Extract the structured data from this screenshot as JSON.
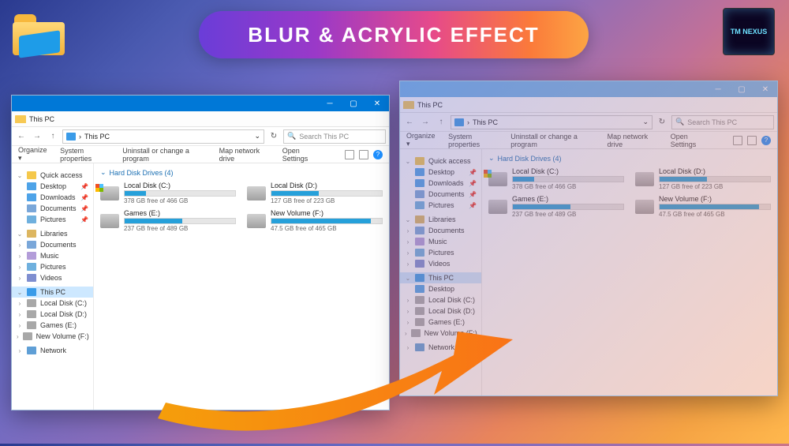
{
  "title_pill": "BLUR & ACRYLIC EFFECT",
  "nexus_label": "TM NEXUS",
  "window": {
    "tab_label": "This PC",
    "addr_location": "This PC",
    "search_placeholder": "Search This PC",
    "cmd": {
      "organize": "Organize ▾",
      "sysprops": "System properties",
      "uninstall": "Uninstall or change a program",
      "mapnet": "Map network drive",
      "opensettings": "Open Settings",
      "help": "?"
    },
    "section_header": "Hard Disk Drives (4)",
    "drives": [
      {
        "name": "Local Disk (C:)",
        "free": "378 GB free of 466 GB",
        "pct": 19
      },
      {
        "name": "Local Disk (D:)",
        "free": "127 GB free of 223 GB",
        "pct": 43
      },
      {
        "name": "Games (E:)",
        "free": "237 GB free of 489 GB",
        "pct": 52
      },
      {
        "name": "New Volume (F:)",
        "free": "47.5 GB free of 465 GB",
        "pct": 90
      }
    ]
  },
  "sidebar": {
    "qa": "Quick access",
    "desktop": "Desktop",
    "downloads": "Downloads",
    "documents": "Documents",
    "pictures": "Pictures",
    "libraries": "Libraries",
    "lib_documents": "Documents",
    "lib_music": "Music",
    "lib_pictures": "Pictures",
    "lib_videos": "Videos",
    "thispc": "This PC",
    "localdisk_c": "Local Disk (C:)",
    "localdisk_d": "Local Disk (D:)",
    "games_e": "Games (E:)",
    "newvol_f": "New Volume (F:)",
    "network": "Network"
  }
}
